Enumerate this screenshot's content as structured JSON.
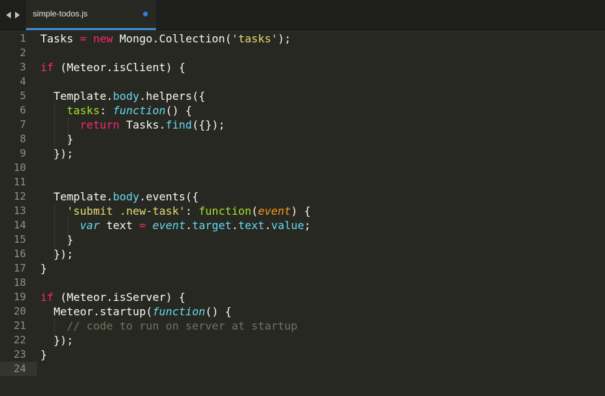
{
  "tab": {
    "filename": "simple-todos.js",
    "modified": true,
    "accent_color": "#3f8cd6",
    "dirty_dot_color": "#2f7fd2"
  },
  "nav": {
    "back_icon": "triangle-left",
    "forward_icon": "triangle-right"
  },
  "editor": {
    "theme_colors": {
      "background": "#272822",
      "keyword": "#f92672",
      "string": "#e6db74",
      "function": "#66d9ef",
      "property": "#a6e22e",
      "parameter": "#fd971f",
      "comment": "#75715e",
      "text": "#f8f8f2"
    },
    "current_line": 24,
    "lines": [
      {
        "n": "1",
        "tokens": [
          [
            "plain",
            "Tasks "
          ],
          [
            "kw",
            "="
          ],
          [
            "plain",
            " "
          ],
          [
            "kw",
            "new"
          ],
          [
            "plain",
            " Mongo.Collection("
          ],
          [
            "str",
            "'tasks'"
          ],
          [
            "plain",
            ");"
          ]
        ]
      },
      {
        "n": "2",
        "tokens": []
      },
      {
        "n": "3",
        "tokens": [
          [
            "kw",
            "if"
          ],
          [
            "plain",
            " (Meteor.isClient) {"
          ]
        ]
      },
      {
        "n": "4",
        "tokens": []
      },
      {
        "n": "5",
        "tokens": [
          [
            "plain",
            "  Template."
          ],
          [
            "prop",
            "body"
          ],
          [
            "plain",
            "."
          ],
          [
            "plain",
            "helpers({"
          ]
        ]
      },
      {
        "n": "6",
        "tokens": [
          [
            "plain",
            "    "
          ],
          [
            "key",
            "tasks"
          ],
          [
            "plain",
            ": "
          ],
          [
            "fn",
            "function"
          ],
          [
            "plain",
            "() {"
          ]
        ]
      },
      {
        "n": "7",
        "tokens": [
          [
            "plain",
            "      "
          ],
          [
            "kw",
            "return"
          ],
          [
            "plain",
            " Tasks."
          ],
          [
            "prop",
            "find"
          ],
          [
            "plain",
            "({});"
          ]
        ]
      },
      {
        "n": "8",
        "tokens": [
          [
            "plain",
            "    }"
          ]
        ]
      },
      {
        "n": "9",
        "tokens": [
          [
            "plain",
            "  });"
          ]
        ]
      },
      {
        "n": "10",
        "tokens": []
      },
      {
        "n": "11",
        "tokens": []
      },
      {
        "n": "12",
        "tokens": [
          [
            "plain",
            "  Template."
          ],
          [
            "prop",
            "body"
          ],
          [
            "plain",
            ".events({"
          ]
        ]
      },
      {
        "n": "13",
        "tokens": [
          [
            "plain",
            "    "
          ],
          [
            "str",
            "'submit .new-task'"
          ],
          [
            "plain",
            ": "
          ],
          [
            "fname",
            "function"
          ],
          [
            "plain",
            "("
          ],
          [
            "param",
            "event"
          ],
          [
            "plain",
            ") {"
          ]
        ]
      },
      {
        "n": "14",
        "tokens": [
          [
            "plain",
            "      "
          ],
          [
            "fn",
            "var"
          ],
          [
            "plain",
            " text "
          ],
          [
            "kw",
            "="
          ],
          [
            "plain",
            " "
          ],
          [
            "fn",
            "event"
          ],
          [
            "plain",
            "."
          ],
          [
            "prop",
            "target"
          ],
          [
            "plain",
            "."
          ],
          [
            "prop",
            "text"
          ],
          [
            "plain",
            "."
          ],
          [
            "prop",
            "value"
          ],
          [
            "plain",
            ";"
          ]
        ]
      },
      {
        "n": "15",
        "tokens": [
          [
            "plain",
            "    }"
          ]
        ]
      },
      {
        "n": "16",
        "tokens": [
          [
            "plain",
            "  });"
          ]
        ]
      },
      {
        "n": "17",
        "tokens": [
          [
            "plain",
            "}"
          ]
        ]
      },
      {
        "n": "18",
        "tokens": []
      },
      {
        "n": "19",
        "tokens": [
          [
            "kw",
            "if"
          ],
          [
            "plain",
            " (Meteor.isServer) {"
          ]
        ]
      },
      {
        "n": "20",
        "tokens": [
          [
            "plain",
            "  Meteor.startup("
          ],
          [
            "fn",
            "function"
          ],
          [
            "plain",
            "() {"
          ]
        ]
      },
      {
        "n": "21",
        "tokens": [
          [
            "plain",
            "    "
          ],
          [
            "cmt",
            "// code to run on server at startup"
          ]
        ]
      },
      {
        "n": "22",
        "tokens": [
          [
            "plain",
            "  });"
          ]
        ]
      },
      {
        "n": "23",
        "tokens": [
          [
            "plain",
            "}"
          ]
        ]
      },
      {
        "n": "24",
        "tokens": []
      }
    ]
  }
}
